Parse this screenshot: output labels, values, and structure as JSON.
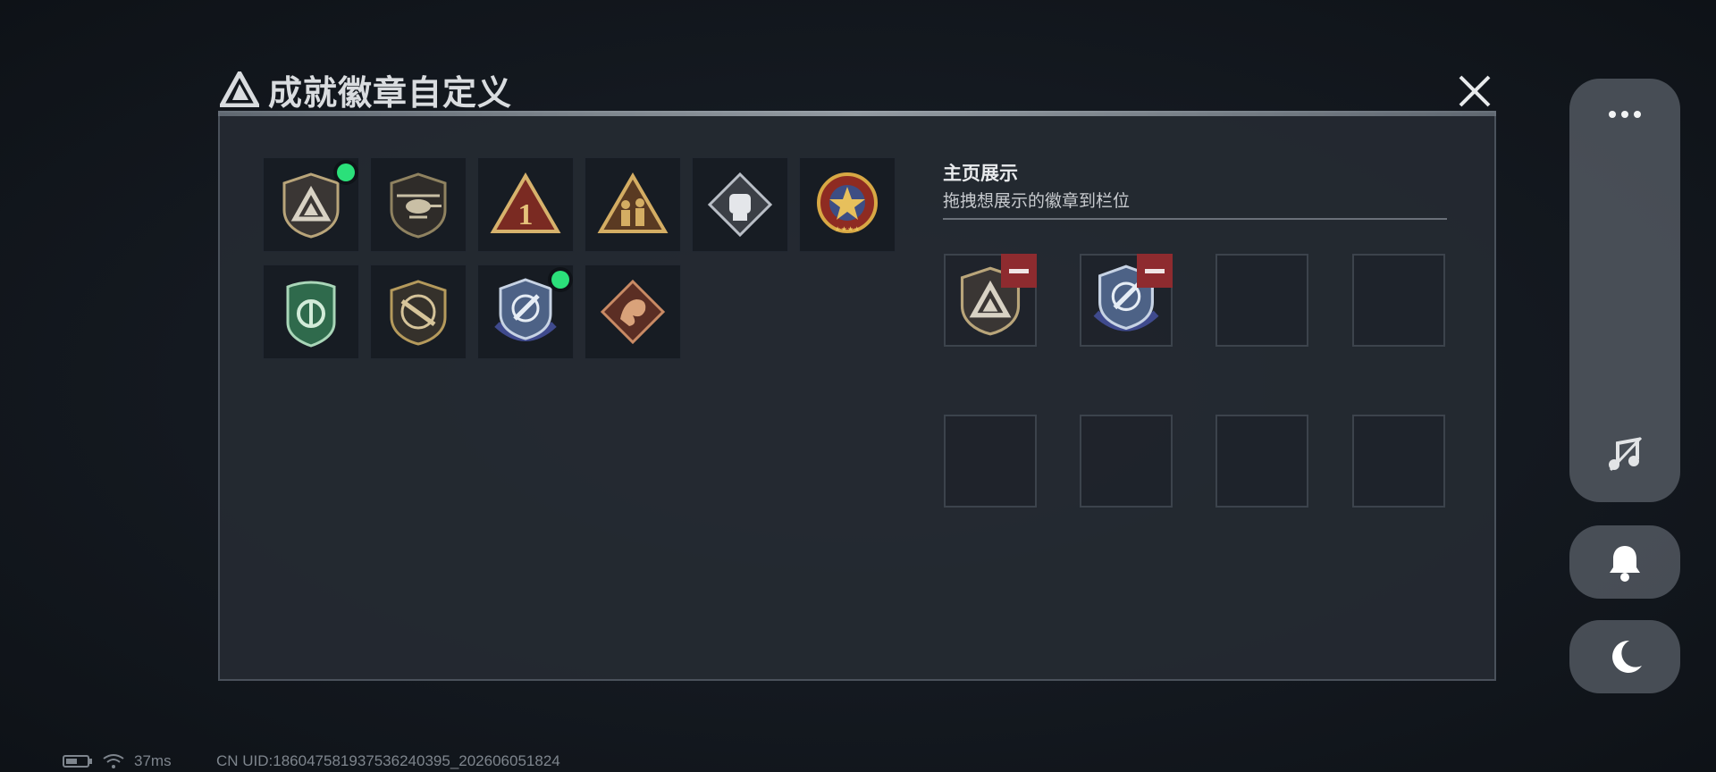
{
  "window": {
    "title": "成就徽章自定义"
  },
  "badges": [
    {
      "icon": "triangle-shield-badge-icon",
      "equipped": true
    },
    {
      "icon": "helicopter-badge-icon",
      "equipped": false
    },
    {
      "icon": "number-one-triangle-badge-icon",
      "equipped": false
    },
    {
      "icon": "soldiers-triangle-badge-icon",
      "equipped": false
    },
    {
      "icon": "fist-diamond-badge-icon",
      "equipped": false
    },
    {
      "icon": "star-medal-badge-icon",
      "equipped": false
    },
    {
      "icon": "green-shield-badge-icon",
      "equipped": false
    },
    {
      "icon": "rifle-badge-icon",
      "equipped": false
    },
    {
      "icon": "crosshair-shield-badge-icon",
      "equipped": true
    },
    {
      "icon": "dragon-diamond-badge-icon",
      "equipped": false
    }
  ],
  "homepage": {
    "title": "主页展示",
    "subtitle": "拖拽想展示的徽章到栏位",
    "slots": [
      {
        "badge": "triangle-shield-badge-icon"
      },
      {
        "badge": "crosshair-shield-badge-icon"
      },
      {
        "badge": null
      },
      {
        "badge": null
      },
      {
        "badge": null
      },
      {
        "badge": null
      },
      {
        "badge": null
      },
      {
        "badge": null
      }
    ]
  },
  "sidebar": {
    "buttons": [
      "more-icon",
      "music-off-icon",
      "bell-icon",
      "moon-icon"
    ]
  },
  "status": {
    "ping": "37ms",
    "uid": "CN UID:1860475819375362403​95_202606051824"
  },
  "colors": {
    "equipped_dot": "#2be07a",
    "remove": "#8e2b2f",
    "panel": "#252a32"
  }
}
